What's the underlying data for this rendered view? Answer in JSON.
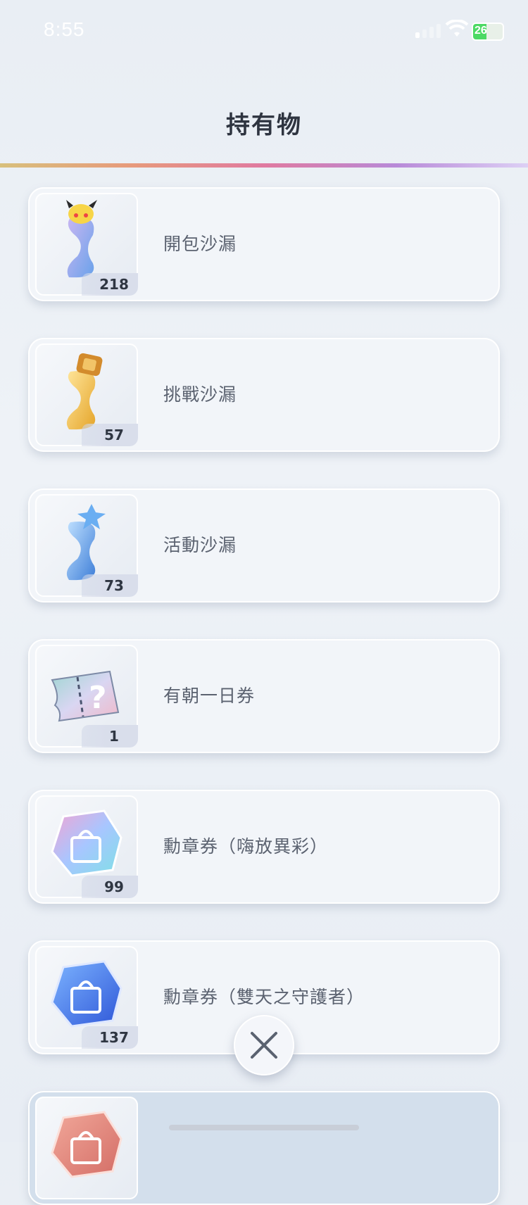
{
  "status": {
    "time": "8:55",
    "battery": "26"
  },
  "header": {
    "title": "持有物"
  },
  "items": [
    {
      "label": "開包沙漏",
      "count": "218",
      "icon": "pack-hourglass-icon"
    },
    {
      "label": "挑戰沙漏",
      "count": "57",
      "icon": "challenge-hourglass-icon"
    },
    {
      "label": "活動沙漏",
      "count": "73",
      "icon": "event-hourglass-icon"
    },
    {
      "label": "有朝一日券",
      "count": "1",
      "icon": "someday-ticket-icon"
    },
    {
      "label": "勳章券（嗨放異彩）",
      "count": "99",
      "icon": "shop-ticket-icon"
    },
    {
      "label": "勳章券（雙天之守護者）",
      "count": "137",
      "icon": "shop-ticket-blue-icon"
    },
    {
      "label": "",
      "count": "",
      "icon": "shop-ticket-red-icon"
    }
  ],
  "close": {
    "icon": "close-icon"
  }
}
